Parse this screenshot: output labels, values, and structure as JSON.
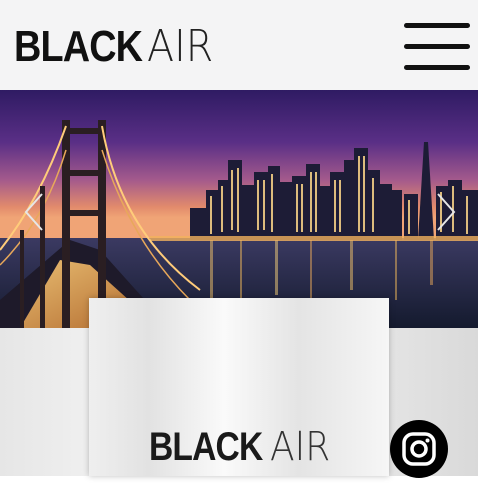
{
  "header": {
    "logo_bold": "BLACK",
    "logo_light": "AIR",
    "menu_icon": "hamburger-menu-icon"
  },
  "hero": {
    "image": "san-francisco-bay-bridge-skyline-at-dusk",
    "prev_icon": "chevron-left-icon",
    "next_icon": "chevron-right-icon"
  },
  "card": {
    "logo_bold": "BLACK",
    "logo_light": "AIR"
  },
  "social": {
    "instagram_icon": "instagram-icon"
  },
  "colors": {
    "header_bg": "#f4f4f5",
    "text_dark": "#111111",
    "sky_top": "#3a1f6e",
    "sky_horizon": "#e08a6a"
  }
}
